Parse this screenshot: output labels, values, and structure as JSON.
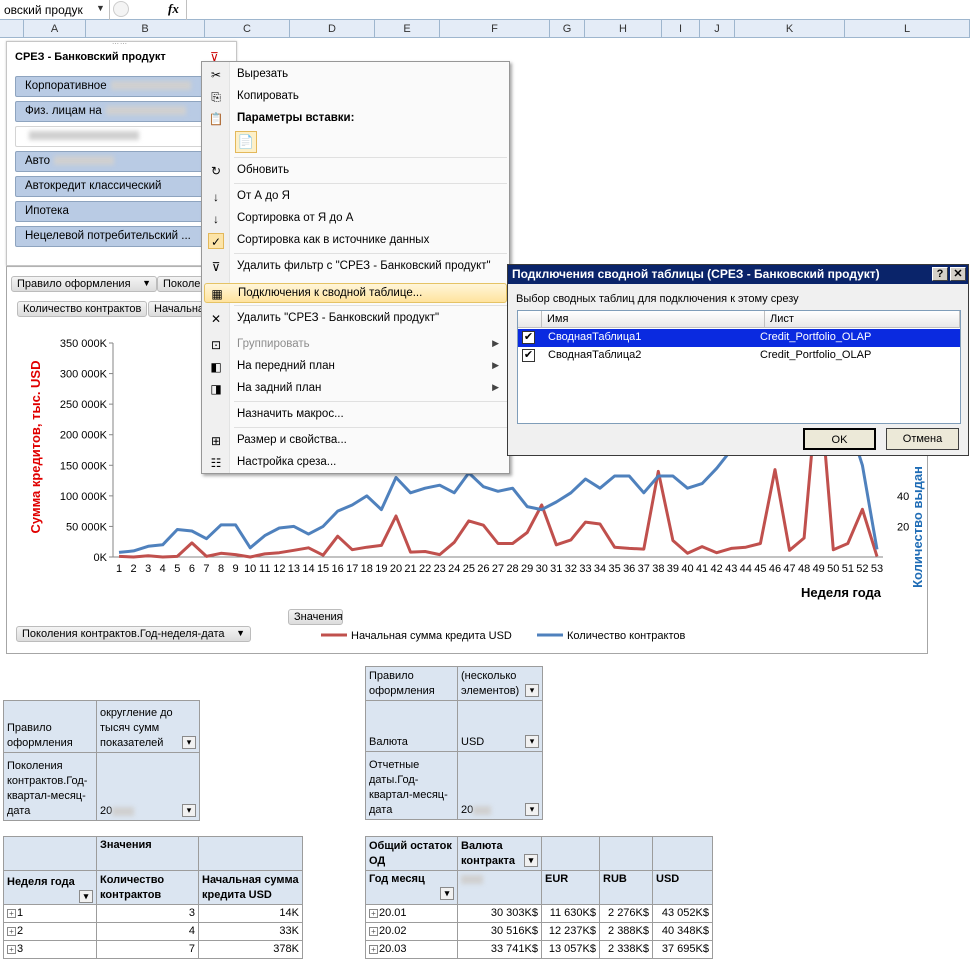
{
  "formula_bar": {
    "name_box": "овский продук",
    "fx": "fx"
  },
  "columns": [
    "A",
    "B",
    "C",
    "D",
    "E",
    "F",
    "G",
    "H",
    "I",
    "J",
    "K",
    "L"
  ],
  "slicer": {
    "title": "СРЕЗ - Банковский продукт",
    "items": [
      {
        "label": "Корпоративное",
        "selected": true
      },
      {
        "label": "Физ. лицам на",
        "selected": true
      },
      {
        "label": "",
        "selected": false
      },
      {
        "label": "Авто",
        "selected": true
      },
      {
        "label": "Автокредит классический",
        "selected": true
      },
      {
        "label": "Ипотека",
        "selected": true
      },
      {
        "label": "Нецелевой потребительский ...",
        "selected": true
      }
    ]
  },
  "pivot_chart_buttons": {
    "rule": "Правило оформления",
    "gen": "Поколе",
    "count": "Количество контрактов",
    "start": "Начальна",
    "values": "Значения",
    "axis_field": "Поколения контрактов.Год-неделя-дата"
  },
  "context_menu": {
    "items": [
      {
        "label": "Вырезать",
        "icon": "scissors-icon"
      },
      {
        "label": "Копировать",
        "icon": "copy-icon"
      },
      {
        "label": "Параметры вставки:",
        "icon": "paste-icon"
      },
      {
        "label": "Обновить",
        "icon": "refresh-icon"
      },
      {
        "label": "От А до Я",
        "icon": "sort-asc-icon"
      },
      {
        "label": "Сортировка от Я до А",
        "icon": "sort-desc-icon"
      },
      {
        "label": "Сортировка как в источнике данных",
        "icon": "check-icon"
      },
      {
        "label": "Удалить фильтр с \"СРЕЗ - Банковский продукт\"",
        "icon": "clear-filter-icon"
      },
      {
        "label": "Подключения к сводной таблице...",
        "icon": "connections-icon"
      },
      {
        "label": "Удалить \"СРЕЗ - Банковский продукт\"",
        "icon": "delete-icon"
      },
      {
        "label": "Группировать",
        "icon": "group-icon"
      },
      {
        "label": "На передний план",
        "icon": "bring-front-icon"
      },
      {
        "label": "На задний план",
        "icon": "send-back-icon"
      },
      {
        "label": "Назначить макрос...",
        "icon": ""
      },
      {
        "label": "Размер и свойства...",
        "icon": "size-icon"
      },
      {
        "label": "Настройка среза...",
        "icon": "slicer-settings-icon"
      }
    ]
  },
  "dialog": {
    "title": "Подключения сводной таблицы (СРЕЗ - Банковский продукт)",
    "help": "?",
    "close": "✕",
    "description": "Выбор сводных таблиц для подключения к этому срезу",
    "col_name": "Имя",
    "col_sheet": "Лист",
    "rows": [
      {
        "name": "СводнаяТаблица1",
        "sheet": "Credit_Portfolio_OLAP",
        "checked": true
      },
      {
        "name": "СводнаяТаблица2",
        "sheet": "Credit_Portfolio_OLAP",
        "checked": true
      }
    ],
    "ok": "OK",
    "cancel": "Отмена"
  },
  "chart_data": {
    "type": "line",
    "title": "",
    "xlabel": "Неделя года",
    "ylabel": "Сумма кредитов, тыс. USD",
    "y2label": "Количество выдан",
    "ylim": [
      0,
      350000
    ],
    "y2lim": [
      0,
      140
    ],
    "yticks": [
      "0K",
      "50 000K",
      "100 000K",
      "150 000K",
      "200 000K",
      "250 000K",
      "300 000K",
      "350 000K"
    ],
    "y2ticks": [
      "20",
      "40"
    ],
    "x": [
      1,
      2,
      3,
      4,
      5,
      6,
      7,
      8,
      9,
      10,
      11,
      12,
      13,
      14,
      15,
      16,
      17,
      18,
      19,
      20,
      21,
      22,
      23,
      24,
      25,
      26,
      27,
      28,
      29,
      30,
      31,
      32,
      33,
      34,
      35,
      36,
      37,
      38,
      39,
      40,
      41,
      42,
      43,
      44,
      45,
      46,
      47,
      48,
      49,
      50,
      51,
      52,
      53
    ],
    "series": [
      {
        "name": "Начальная сумма кредита USD",
        "color": "#c0504d",
        "axis": "left",
        "values": [
          1000,
          0,
          2000,
          0,
          1000,
          23000,
          1000,
          6000,
          4000,
          0,
          5000,
          7000,
          11000,
          15000,
          3000,
          34000,
          12000,
          16000,
          19000,
          67000,
          8000,
          9000,
          4000,
          24000,
          59000,
          52000,
          22000,
          22000,
          40000,
          85000,
          20000,
          28000,
          57000,
          54000,
          16000,
          14000,
          13000,
          140000,
          27000,
          6000,
          17000,
          7000,
          14000,
          16000,
          22000,
          143000,
          11000,
          31000,
          300000,
          12000,
          22000,
          78000,
          1000
        ]
      },
      {
        "name": "Количество контрактов",
        "color": "#4f81bd",
        "axis": "right",
        "values": [
          3,
          4,
          7,
          8,
          18,
          17,
          12,
          21,
          21,
          6,
          14,
          19,
          20,
          15,
          20,
          30,
          34,
          40,
          31,
          52,
          42,
          45,
          47,
          42,
          55,
          46,
          43,
          45,
          33,
          31,
          36,
          42,
          51,
          45,
          53,
          53,
          42,
          53,
          53,
          45,
          48,
          58,
          70,
          80,
          90,
          110,
          100,
          120,
          140,
          115,
          90,
          60,
          5
        ]
      }
    ]
  },
  "filter_table_left": {
    "rows": [
      {
        "label": "Правило оформления",
        "value": "округление до тысяч сумм показателей"
      },
      {
        "label": "Поколения контрактов.Год-квартал-месяц-дата",
        "value": "20"
      }
    ]
  },
  "filter_table_right": {
    "rows": [
      {
        "label": "Правило оформления",
        "value": "(несколько элементов)"
      },
      {
        "label": "Валюта",
        "value": "USD"
      },
      {
        "label": "Отчетные даты.Год-квартал-месяц-дата",
        "value": "20"
      }
    ]
  },
  "pivot_left": {
    "values_header": "Значения",
    "row_header": "Неделя года",
    "col1": "Количество контрактов",
    "col2": "Начальная сумма кредита USD",
    "rows": [
      {
        "key": "1",
        "count": "3",
        "sum": "14K"
      },
      {
        "key": "2",
        "count": "4",
        "sum": "33K"
      },
      {
        "key": "3",
        "count": "7",
        "sum": "378K"
      }
    ]
  },
  "pivot_right": {
    "measure": "Общий остаток ОД",
    "col_field": "Валюта контракта",
    "row_field": "Год месяц",
    "cols": [
      "",
      "EUR",
      "RUB",
      "USD"
    ],
    "rows": [
      {
        "key": "20.01",
        "vals": [
          "30 303K$",
          "11 630K$",
          "2 276K$",
          "43 052K$"
        ]
      },
      {
        "key": "20.02",
        "vals": [
          "30 516K$",
          "12 237K$",
          "2 388K$",
          "40 348K$"
        ]
      },
      {
        "key": "20.03",
        "vals": [
          "33 741K$",
          "13 057K$",
          "2 338K$",
          "37 695K$"
        ]
      }
    ]
  }
}
